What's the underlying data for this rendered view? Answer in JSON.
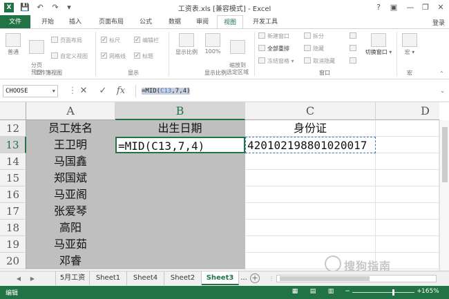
{
  "window": {
    "title": "工资表.xls  [兼容模式] - Excel",
    "controls": {
      "help": "?",
      "ribbon_options": "▣",
      "minimize": "—",
      "restore": "❐",
      "close": "✕"
    }
  },
  "qat": {
    "save_icon": "💾",
    "undo_icon": "↶",
    "redo_icon": "↷",
    "customize_icon": "▾"
  },
  "tabs": [
    "文件",
    "开始",
    "插入",
    "页面布局",
    "公式",
    "数据",
    "审阅",
    "视图",
    "开发工具"
  ],
  "active_tab": "视图",
  "login": "登录",
  "ribbon": {
    "workbook_views": {
      "label": "工作簿视图",
      "normal": "普通",
      "page_break": "分页\n预览",
      "page_layout": "页面布局",
      "custom_views": "自定义视图"
    },
    "show": {
      "label": "显示",
      "ruler": "标尺",
      "formula_bar": "编辑栏",
      "gridlines": "网格线",
      "headings": "标题"
    },
    "zoom": {
      "label": "显示比例",
      "zoom": "显示比例",
      "zoom100": "100%",
      "zoom_selection": "缩放到\n选定区域"
    },
    "window": {
      "label": "窗口",
      "new_window": "新建窗口",
      "arrange_all": "全部重排",
      "freeze_panes": "冻结窗格",
      "split": "拆分",
      "hide": "隐藏",
      "unhide": "取消隐藏",
      "switch_windows": "切换窗口"
    },
    "macros": {
      "label": "宏",
      "macros": "宏"
    }
  },
  "formula_bar": {
    "name_box": "CHOOSE",
    "cancel": "✕",
    "enter": "✓",
    "fx": "fx",
    "formula_prefix": "=MID(",
    "formula_ref": "C13",
    "formula_suffix": ",7,4)",
    "expand": "⌄"
  },
  "grid": {
    "columns": [
      "A",
      "B",
      "C",
      "D"
    ],
    "rows": [
      "12",
      "13",
      "14",
      "15",
      "16",
      "17",
      "18",
      "19",
      "20"
    ],
    "header_row": {
      "name": "员工姓名",
      "birth": "出生日期",
      "id": "身份证"
    },
    "names": [
      "王卫明",
      "马国鑫",
      "郑国斌",
      "马亚阁",
      "张爱琴",
      "高阳",
      "马亚茹",
      "邓睿"
    ],
    "active_cell_content": "=MID(C13,7,4)",
    "id_value": "420102198801020017"
  },
  "sheets": [
    "5月工资",
    "Sheet1",
    "Sheet4",
    "Sheet2",
    "Sheet3"
  ],
  "active_sheet": "Sheet3",
  "sheet_more": "...",
  "status": {
    "mode": "编辑",
    "zoom_percent": "165%",
    "zoom_level": 0.65
  },
  "watermark": "搜狗指南"
}
